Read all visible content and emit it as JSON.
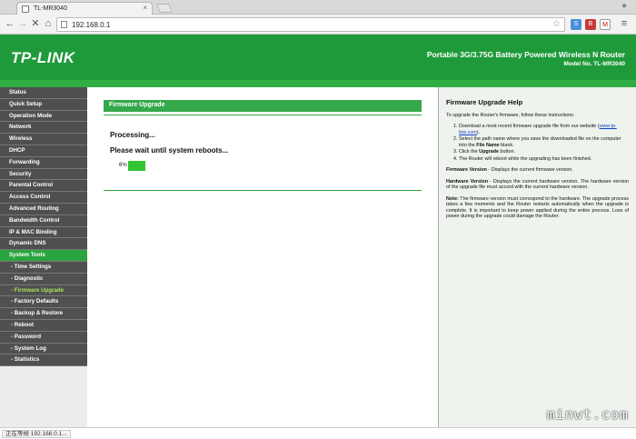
{
  "browser": {
    "tab_title": "TL-MR3040",
    "tab_close": "×",
    "url": "192.168.0.1",
    "back": "←",
    "forward": "→",
    "stop": "✕",
    "home": "⌂",
    "star": "☆",
    "menu": "≡",
    "status_text": "正在等候 192.168.0.1..."
  },
  "header": {
    "logo": "TP-LINK",
    "product_name": "Portable 3G/3.75G Battery Powered Wireless N Router",
    "model": "Model No. TL-MR3040"
  },
  "sidebar": {
    "items": [
      {
        "label": "Status",
        "type": "top"
      },
      {
        "label": "Quick Setup",
        "type": "top"
      },
      {
        "label": "Operation Mode",
        "type": "top"
      },
      {
        "label": "Network",
        "type": "top"
      },
      {
        "label": "Wireless",
        "type": "top"
      },
      {
        "label": "DHCP",
        "type": "top"
      },
      {
        "label": "Forwarding",
        "type": "top"
      },
      {
        "label": "Security",
        "type": "top"
      },
      {
        "label": "Parental Control",
        "type": "top"
      },
      {
        "label": "Access Control",
        "type": "top"
      },
      {
        "label": "Advanced Routing",
        "type": "top"
      },
      {
        "label": "Bandwidth Control",
        "type": "top"
      },
      {
        "label": "IP & MAC Binding",
        "type": "top"
      },
      {
        "label": "Dynamic DNS",
        "type": "top"
      },
      {
        "label": "System Tools",
        "type": "active"
      },
      {
        "label": "- Time Settings",
        "type": "sub"
      },
      {
        "label": "- Diagnostic",
        "type": "sub"
      },
      {
        "label": "- Firmware Upgrade",
        "type": "current"
      },
      {
        "label": "- Factory Defaults",
        "type": "sub"
      },
      {
        "label": "- Backup & Restore",
        "type": "sub"
      },
      {
        "label": "- Reboot",
        "type": "sub"
      },
      {
        "label": "- Password",
        "type": "sub"
      },
      {
        "label": "- System Log",
        "type": "sub"
      },
      {
        "label": "- Statistics",
        "type": "sub"
      }
    ]
  },
  "main": {
    "section_title": "Firmware Upgrade",
    "processing": "Processing...",
    "wait_text": "Please wait until system reboots...",
    "progress_label": "6%",
    "progress_value": 0.06
  },
  "help": {
    "title": "Firmware Upgrade Help",
    "intro": "To upgrade the Router's firmware, follow these instructions:",
    "step1_a": "Download a most recent firmware upgrade file from our website (",
    "step1_link": "www.tp-link.com",
    "step1_b": ").",
    "step2_a": "Select the path name where you save the downloaded file on the computer into the ",
    "step2_bold": "File Name",
    "step2_b": " blank.",
    "step3_a": "Click the ",
    "step3_bold": "Upgrade",
    "step3_b": " button.",
    "step4": "The Router will reboot while the upgrading has been finished.",
    "fw_label": "Firmware Version",
    "fw_text": " - Displays the current firmware version.",
    "hw_label": "Hardware Version",
    "hw_text": " - Displays the current hardware version. The hardware version of the upgrade file must accord with the current hardware version.",
    "note_label": "Note:",
    "note_text": " The firmware version must correspond to the hardware. The upgrade process takes a few moments and the Router restarts automatically when the upgrade is complete. It is important to keep power applied during the entire process. Loss of power during the upgrade could damage the Router."
  },
  "watermark": "minwt.com"
}
